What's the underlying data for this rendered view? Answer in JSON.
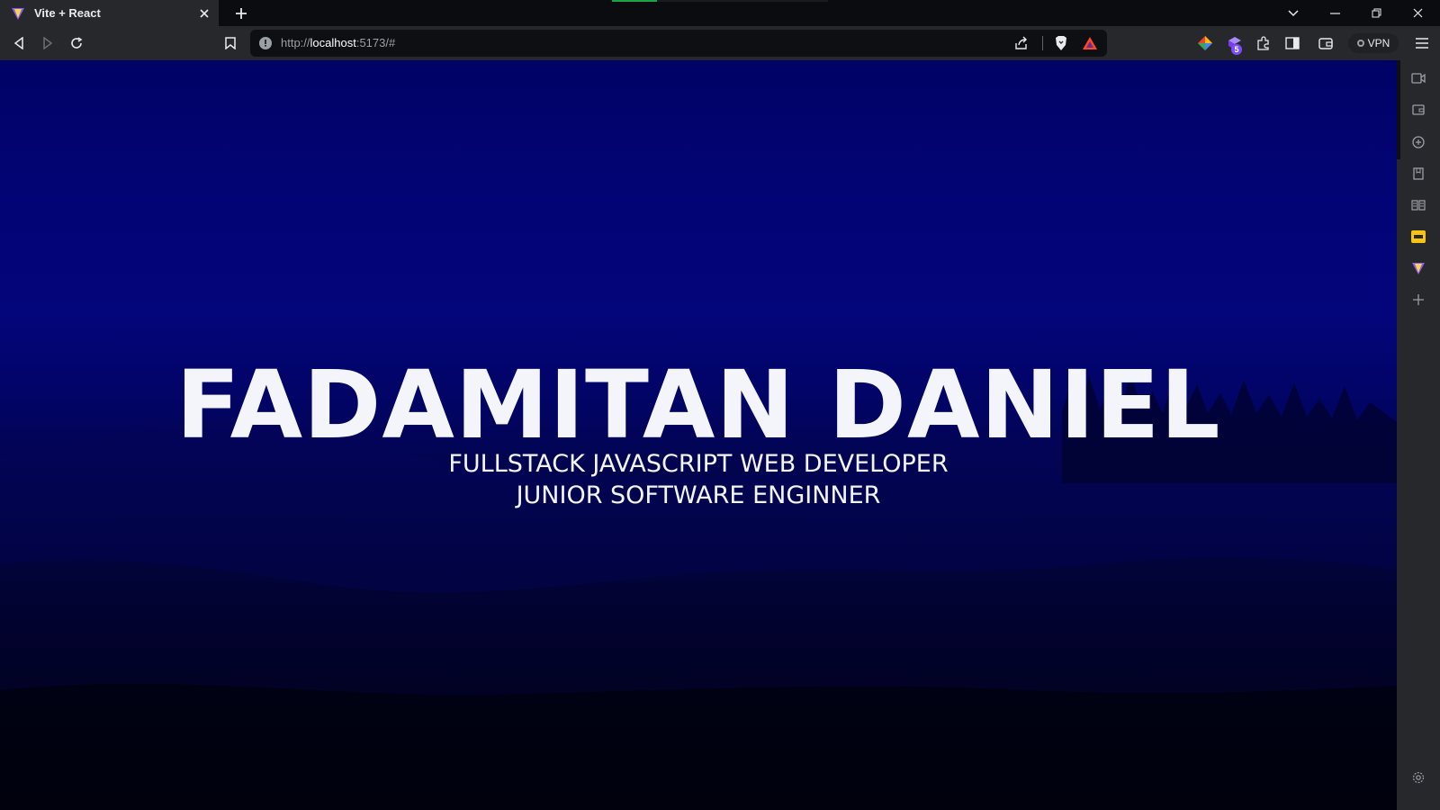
{
  "browser": {
    "tab": {
      "title": "Vite + React",
      "favicon": "vite-logo-icon"
    },
    "address_bar": {
      "scheme": "http://",
      "host": "localhost",
      "rest": ":5173/#"
    },
    "vpn_label": "VPN",
    "extensions_badge": "5",
    "colors": {
      "tabstrip": "#0b0c10",
      "toolbar": "#27282c",
      "omnibox": "#0e0f12",
      "loading": "#1ca348"
    }
  },
  "hero": {
    "name": "FADAMITAN DANIEL",
    "role_line1": "FULLSTACK JAVASCRIPT WEB DEVELOPER",
    "role_line2": "JUNIOR SOFTWARE ENGINNER",
    "colors": {
      "text": "#f3f5fb",
      "sky": "#03057a",
      "ground": "#010218"
    }
  },
  "sidebar": {
    "icons": [
      "video-call-icon",
      "wallet-icon",
      "crypto-icon",
      "bookmarks-icon",
      "reading-list-icon",
      "wallet-card-icon",
      "vite-pinned-icon",
      "add-panel-icon",
      "settings-icon"
    ]
  }
}
